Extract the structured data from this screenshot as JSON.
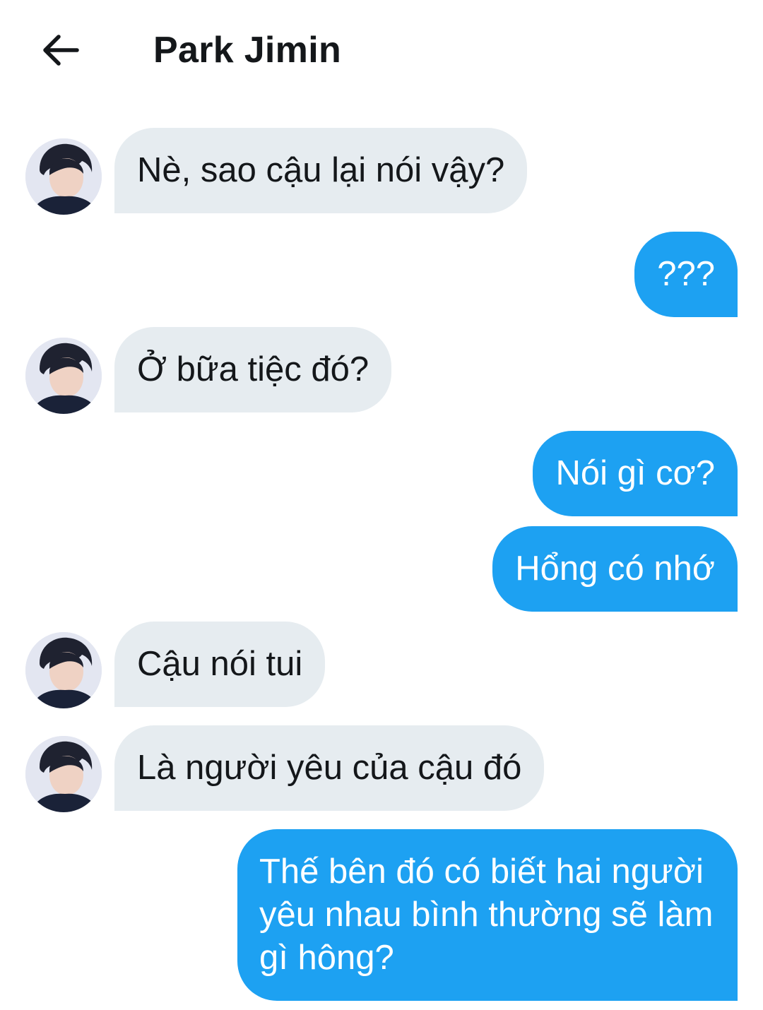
{
  "header": {
    "title": "Park Jimin"
  },
  "messages": [
    {
      "side": "in",
      "text": "Nè, sao cậu lại nói vậy?"
    },
    {
      "side": "out",
      "text": "???"
    },
    {
      "side": "in",
      "text": "Ở bữa tiệc đó?"
    },
    {
      "side": "out",
      "text": "Nói gì cơ?"
    },
    {
      "side": "out",
      "text": "Hổng có nhớ"
    },
    {
      "side": "in",
      "text": "Cậu nói tui"
    },
    {
      "side": "in",
      "text": "Là người yêu của cậu đó"
    },
    {
      "side": "out",
      "text": "Thế bên đó có biết hai người yêu nhau bình thường sẽ làm gì hông?"
    }
  ],
  "colors": {
    "incoming_bubble": "#e6ecf0",
    "outgoing_bubble": "#1da1f2",
    "text_dark": "#14171a"
  },
  "icons": {
    "back": "arrow-left-icon"
  }
}
